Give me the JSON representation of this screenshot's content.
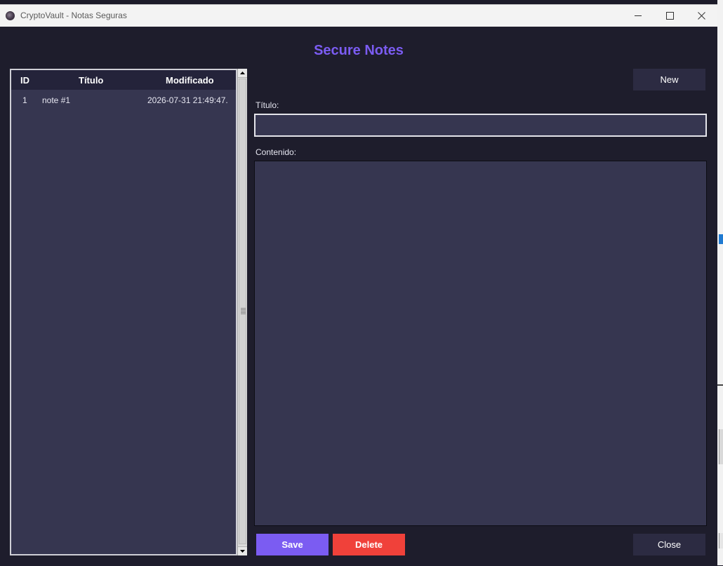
{
  "window": {
    "title": "CryptoVault - Notas Seguras"
  },
  "heading": "Secure Notes",
  "notes_table": {
    "columns": [
      "ID",
      "Título",
      "Modificado"
    ],
    "rows": [
      {
        "id": "1",
        "title": "note #1",
        "modified": "2026-07-31 21:49:47."
      }
    ]
  },
  "editor": {
    "new_label": "New",
    "title_label": "Título:",
    "title_value": "",
    "content_label": "Contenido:",
    "content_value": "",
    "save_label": "Save",
    "delete_label": "Delete",
    "close_label": "Close"
  },
  "colors": {
    "accent": "#7b5cf2",
    "danger": "#f0413a",
    "background": "#1e1d2c",
    "panel": "#363650"
  },
  "icons": {
    "app": "app-icon",
    "minimize": "minimize-icon",
    "maximize": "maximize-icon",
    "close": "close-icon",
    "scroll_up": "arrow-up-icon",
    "scroll_down": "arrow-down-icon"
  }
}
